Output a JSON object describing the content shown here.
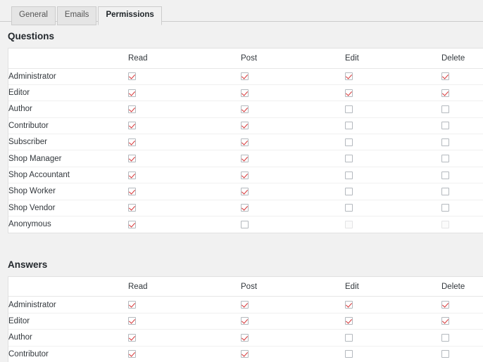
{
  "tabs": [
    {
      "label": "General",
      "active": false
    },
    {
      "label": "Emails",
      "active": false
    },
    {
      "label": "Permissions",
      "active": true
    }
  ],
  "columns": [
    "Read",
    "Post",
    "Edit",
    "Delete"
  ],
  "colors": {
    "page_background": "#f1f1f1",
    "table_background": "#ffffff",
    "checkmark": "#d63638",
    "checkbox_border": "#b4b9be",
    "text": "#32373c",
    "tab_inactive_background": "#e5e5e5"
  },
  "sections": [
    {
      "title": "Questions",
      "columns": [
        "Read",
        "Post",
        "Edit",
        "Delete"
      ],
      "rows": [
        {
          "role": "Administrator",
          "cells": [
            {
              "checked": true,
              "disabled": false
            },
            {
              "checked": true,
              "disabled": false
            },
            {
              "checked": true,
              "disabled": false
            },
            {
              "checked": true,
              "disabled": false
            }
          ]
        },
        {
          "role": "Editor",
          "cells": [
            {
              "checked": true,
              "disabled": false
            },
            {
              "checked": true,
              "disabled": false
            },
            {
              "checked": true,
              "disabled": false
            },
            {
              "checked": true,
              "disabled": false
            }
          ]
        },
        {
          "role": "Author",
          "cells": [
            {
              "checked": true,
              "disabled": false
            },
            {
              "checked": true,
              "disabled": false
            },
            {
              "checked": false,
              "disabled": false
            },
            {
              "checked": false,
              "disabled": false
            }
          ]
        },
        {
          "role": "Contributor",
          "cells": [
            {
              "checked": true,
              "disabled": false
            },
            {
              "checked": true,
              "disabled": false
            },
            {
              "checked": false,
              "disabled": false
            },
            {
              "checked": false,
              "disabled": false
            }
          ]
        },
        {
          "role": "Subscriber",
          "cells": [
            {
              "checked": true,
              "disabled": false
            },
            {
              "checked": true,
              "disabled": false
            },
            {
              "checked": false,
              "disabled": false
            },
            {
              "checked": false,
              "disabled": false
            }
          ]
        },
        {
          "role": "Shop Manager",
          "cells": [
            {
              "checked": true,
              "disabled": false
            },
            {
              "checked": true,
              "disabled": false
            },
            {
              "checked": false,
              "disabled": false
            },
            {
              "checked": false,
              "disabled": false
            }
          ]
        },
        {
          "role": "Shop Accountant",
          "cells": [
            {
              "checked": true,
              "disabled": false
            },
            {
              "checked": true,
              "disabled": false
            },
            {
              "checked": false,
              "disabled": false
            },
            {
              "checked": false,
              "disabled": false
            }
          ]
        },
        {
          "role": "Shop Worker",
          "cells": [
            {
              "checked": true,
              "disabled": false
            },
            {
              "checked": true,
              "disabled": false
            },
            {
              "checked": false,
              "disabled": false
            },
            {
              "checked": false,
              "disabled": false
            }
          ]
        },
        {
          "role": "Shop Vendor",
          "cells": [
            {
              "checked": true,
              "disabled": false
            },
            {
              "checked": true,
              "disabled": false
            },
            {
              "checked": false,
              "disabled": false
            },
            {
              "checked": false,
              "disabled": false
            }
          ]
        },
        {
          "role": "Anonymous",
          "cells": [
            {
              "checked": true,
              "disabled": false
            },
            {
              "checked": false,
              "disabled": false
            },
            {
              "checked": false,
              "disabled": true
            },
            {
              "checked": false,
              "disabled": true
            }
          ]
        }
      ]
    },
    {
      "title": "Answers",
      "columns": [
        "Read",
        "Post",
        "Edit",
        "Delete"
      ],
      "rows": [
        {
          "role": "Administrator",
          "cells": [
            {
              "checked": true,
              "disabled": false
            },
            {
              "checked": true,
              "disabled": false
            },
            {
              "checked": true,
              "disabled": false
            },
            {
              "checked": true,
              "disabled": false
            }
          ]
        },
        {
          "role": "Editor",
          "cells": [
            {
              "checked": true,
              "disabled": false
            },
            {
              "checked": true,
              "disabled": false
            },
            {
              "checked": true,
              "disabled": false
            },
            {
              "checked": true,
              "disabled": false
            }
          ]
        },
        {
          "role": "Author",
          "cells": [
            {
              "checked": true,
              "disabled": false
            },
            {
              "checked": true,
              "disabled": false
            },
            {
              "checked": false,
              "disabled": false
            },
            {
              "checked": false,
              "disabled": false
            }
          ]
        },
        {
          "role": "Contributor",
          "cells": [
            {
              "checked": true,
              "disabled": false
            },
            {
              "checked": true,
              "disabled": false
            },
            {
              "checked": false,
              "disabled": false
            },
            {
              "checked": false,
              "disabled": false
            }
          ]
        }
      ]
    }
  ]
}
